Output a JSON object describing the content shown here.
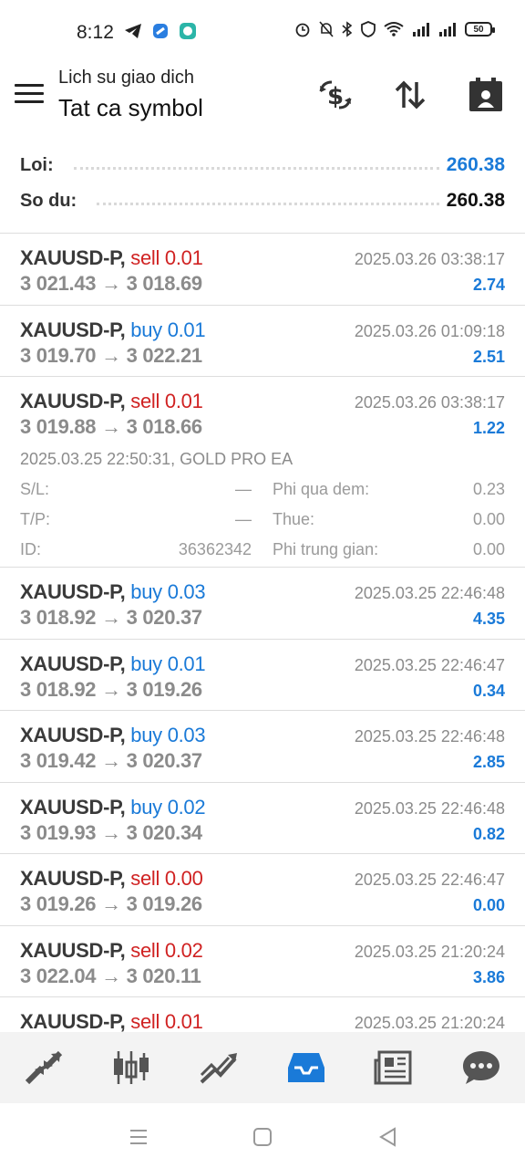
{
  "status_bar": {
    "time": "8:12",
    "battery": "50"
  },
  "header": {
    "subtitle": "Lich su giao dich",
    "title": "Tat ca symbol"
  },
  "summary": {
    "profit_label": "Loi:",
    "profit_value": "260.38",
    "balance_label": "So du:",
    "balance_value": "260.38"
  },
  "trades": [
    {
      "symbol": "XAUUSD-P,",
      "side": "sell",
      "volume": "0.01",
      "open": "3 021.43",
      "close": "3 018.69",
      "time": "2025.03.26 03:38:17",
      "profit": "2.74"
    },
    {
      "symbol": "XAUUSD-P,",
      "side": "buy",
      "volume": "0.01",
      "open": "3 019.70",
      "close": "3 022.21",
      "time": "2025.03.26 01:09:18",
      "profit": "2.51"
    },
    {
      "symbol": "XAUUSD-P,",
      "side": "sell",
      "volume": "0.01",
      "open": "3 019.88",
      "close": "3 018.66",
      "time": "2025.03.26 03:38:17",
      "profit": "1.22",
      "details": {
        "opened": "2025.03.25 22:50:31, GOLD PRO EA",
        "sl_label": "S/L:",
        "sl_value": "—",
        "tp_label": "T/P:",
        "tp_value": "—",
        "id_label": "ID:",
        "id_value": "36362342",
        "swap_label": "Phi qua dem:",
        "swap_value": "0.23",
        "tax_label": "Thue:",
        "tax_value": "0.00",
        "commission_label": "Phi trung gian:",
        "commission_value": "0.00"
      }
    },
    {
      "symbol": "XAUUSD-P,",
      "side": "buy",
      "volume": "0.03",
      "open": "3 018.92",
      "close": "3 020.37",
      "time": "2025.03.25 22:46:48",
      "profit": "4.35"
    },
    {
      "symbol": "XAUUSD-P,",
      "side": "buy",
      "volume": "0.01",
      "open": "3 018.92",
      "close": "3 019.26",
      "time": "2025.03.25 22:46:47",
      "profit": "0.34"
    },
    {
      "symbol": "XAUUSD-P,",
      "side": "buy",
      "volume": "0.03",
      "open": "3 019.42",
      "close": "3 020.37",
      "time": "2025.03.25 22:46:48",
      "profit": "2.85"
    },
    {
      "symbol": "XAUUSD-P,",
      "side": "buy",
      "volume": "0.02",
      "open": "3 019.93",
      "close": "3 020.34",
      "time": "2025.03.25 22:46:48",
      "profit": "0.82"
    },
    {
      "symbol": "XAUUSD-P,",
      "side": "sell",
      "volume": "0.00",
      "open": "3 019.26",
      "close": "3 019.26",
      "time": "2025.03.25 22:46:47",
      "profit": "0.00"
    },
    {
      "symbol": "XAUUSD-P,",
      "side": "sell",
      "volume": "0.02",
      "open": "3 022.04",
      "close": "3 020.11",
      "time": "2025.03.25 21:20:24",
      "profit": "3.86"
    },
    {
      "symbol": "XAUUSD-P,",
      "side": "sell",
      "volume": "0.01",
      "open": "",
      "close": "",
      "time": "2025.03.25 21:20:24",
      "profit": ""
    }
  ],
  "arrow": "→",
  "colors": {
    "accent": "#1a7ad8",
    "sell": "#d02222",
    "nav_active": "#1a7ad8"
  },
  "bottom_nav": [
    {
      "icon": "quotes-icon",
      "active": false
    },
    {
      "icon": "chart-icon",
      "active": false
    },
    {
      "icon": "trade-icon",
      "active": false
    },
    {
      "icon": "history-icon",
      "active": true
    },
    {
      "icon": "news-icon",
      "active": false
    },
    {
      "icon": "messages-icon",
      "active": false
    }
  ]
}
